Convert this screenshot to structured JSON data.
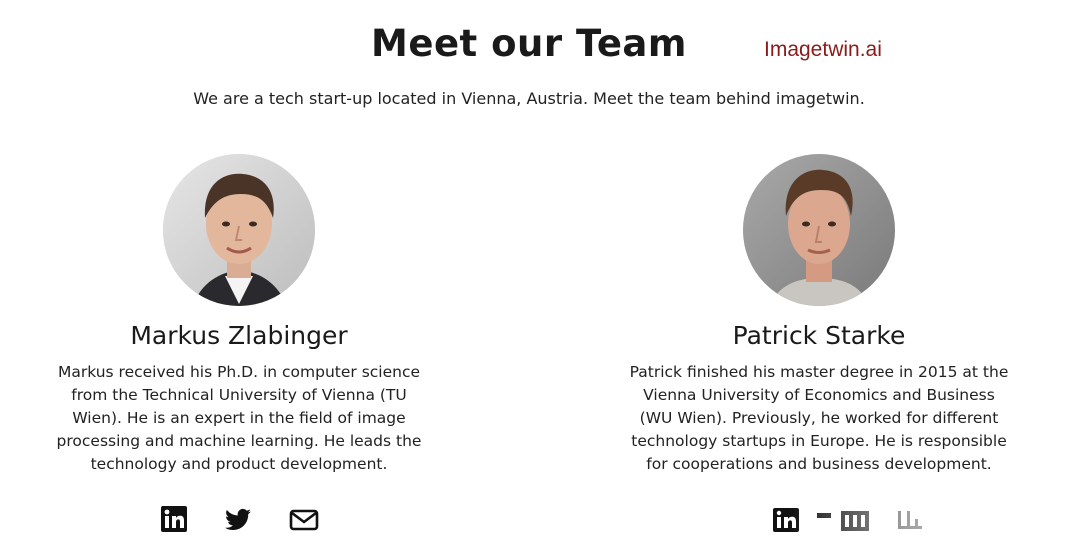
{
  "header": {
    "title": "Meet our Team",
    "watermark": "Imagetwin.ai",
    "tagline": "We are a tech start-up located in Vienna, Austria. Meet the team behind imagetwin."
  },
  "team": [
    {
      "name": "Markus Zlabinger",
      "bio_lines": [
        "Markus received his Ph.D. in computer science",
        "from the Technical University of Vienna (TU",
        "Wien). He is an expert in the field of image",
        "processing and machine learning. He leads the",
        "technology and product development."
      ],
      "socials": [
        "linkedin-icon",
        "twitter-icon",
        "mail-icon"
      ]
    },
    {
      "name": "Patrick Starke",
      "bio_lines": [
        "Patrick finished his master degree in 2015 at the",
        "Vienna University of Economics and Business",
        "(WU Wien). Previously, he worked for different",
        "technology startups in Europe. He is responsible",
        "for cooperations and business development."
      ],
      "socials": [
        "linkedin-icon",
        "twitter-icon",
        "mail-icon"
      ]
    }
  ],
  "colors": {
    "text": "#1c1c1c",
    "watermark": "#8b1a1a",
    "background": "#ffffff"
  }
}
